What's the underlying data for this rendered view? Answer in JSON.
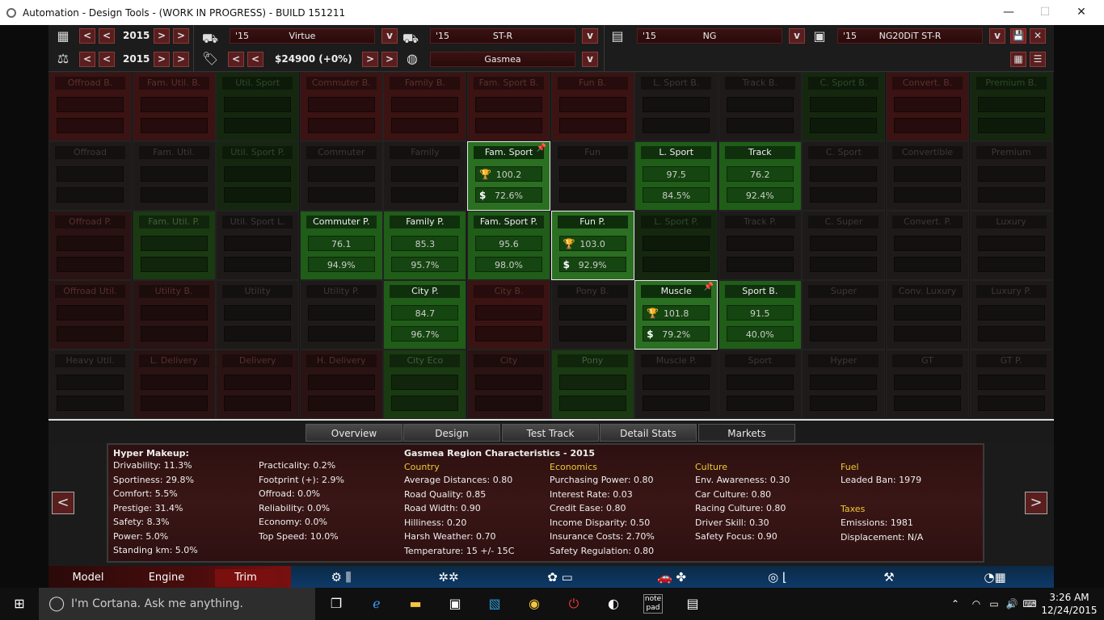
{
  "window": {
    "title": "Automation - Design Tools - (WORK IN PROGRESS) - BUILD 151211",
    "minimize": "—",
    "maximize": "☐",
    "close": "✕"
  },
  "topbar": {
    "year1": "2015",
    "year2": "2015",
    "price": "$24900 (+0%)",
    "model_year": "'15",
    "model_name": "Virtue",
    "trim_year": "'15",
    "trim_name": "ST-R",
    "region": "Gasmea",
    "engine_year": "'15",
    "engine_name": "NG",
    "variant_year": "'15",
    "variant_name": "NG20DiT ST-R",
    "btn_prev_prev": "<",
    "btn_prev": "<",
    "btn_next": ">",
    "btn_next_next": ">",
    "dropdown": "v",
    "save": "💾",
    "close": "✕"
  },
  "grid": {
    "rows": [
      [
        {
          "title": "Offroad B.",
          "c": "red"
        },
        {
          "title": "Fam. Util. B.",
          "c": "red"
        },
        {
          "title": "Util. Sport",
          "c": "dgreen"
        },
        {
          "title": "Commuter B.",
          "c": "red"
        },
        {
          "title": "Family B.",
          "c": "red"
        },
        {
          "title": "Fam. Sport B.",
          "c": "red"
        },
        {
          "title": "Fun B.",
          "c": "red"
        },
        {
          "title": "L. Sport B.",
          "c": "dgray"
        },
        {
          "title": "Track B.",
          "c": "dgray"
        },
        {
          "title": "C. Sport B.",
          "c": "dgreen"
        },
        {
          "title": "Convert. B.",
          "c": "red"
        },
        {
          "title": "Premium B.",
          "c": "dgreen"
        }
      ],
      [
        {
          "title": "Offroad",
          "c": "dgray"
        },
        {
          "title": "Fam. Util.",
          "c": "dgray"
        },
        {
          "title": "Util. Sport P.",
          "c": "dgreen"
        },
        {
          "title": "Commuter",
          "c": "dgray"
        },
        {
          "title": "Family",
          "c": "dgray"
        },
        {
          "title": "Fam. Sport",
          "c": "act",
          "hl": true,
          "pin": true,
          "v1": "100.2",
          "v2": "72.6%"
        },
        {
          "title": "Fun",
          "c": "dgray"
        },
        {
          "title": "L. Sport",
          "c": "act",
          "v1": "97.5",
          "v2": "84.5%"
        },
        {
          "title": "Track",
          "c": "act",
          "v1": "76.2",
          "v2": "92.4%"
        },
        {
          "title": "C. Sport",
          "c": "dgray"
        },
        {
          "title": "Convertible",
          "c": "dgray"
        },
        {
          "title": "Premium",
          "c": "dgray"
        }
      ],
      [
        {
          "title": "Offroad P.",
          "c": "dred"
        },
        {
          "title": "Fam. Util. P.",
          "c": "mgreen"
        },
        {
          "title": "Util. Sport L.",
          "c": "dgray"
        },
        {
          "title": "Commuter P.",
          "c": "act",
          "v1": "76.1",
          "v2": "94.9%"
        },
        {
          "title": "Family P.",
          "c": "act",
          "v1": "85.3",
          "v2": "95.7%"
        },
        {
          "title": "Fam. Sport P.",
          "c": "act",
          "v1": "95.6",
          "v2": "98.0%"
        },
        {
          "title": "Fun P.",
          "c": "act",
          "hl": true,
          "v1": "103.0",
          "v2": "92.9%"
        },
        {
          "title": "L. Sport P.",
          "c": "dgreen"
        },
        {
          "title": "Track P.",
          "c": "dgray"
        },
        {
          "title": "C. Super",
          "c": "dgray"
        },
        {
          "title": "Convert. P.",
          "c": "dgray"
        },
        {
          "title": "Luxury",
          "c": "dgray"
        }
      ],
      [
        {
          "title": "Offroad Util.",
          "c": "dred"
        },
        {
          "title": "Utility B.",
          "c": "dred"
        },
        {
          "title": "Utility",
          "c": "dgray"
        },
        {
          "title": "Utility P.",
          "c": "dgray"
        },
        {
          "title": "City P.",
          "c": "act",
          "v1": "84.7",
          "v2": "96.7%"
        },
        {
          "title": "City B.",
          "c": "red"
        },
        {
          "title": "Pony B.",
          "c": "dgray"
        },
        {
          "title": "Muscle",
          "c": "act",
          "hl": true,
          "pin": true,
          "v1": "101.8",
          "v2": "79.2%"
        },
        {
          "title": "Sport B.",
          "c": "act",
          "v1": "91.5",
          "v2": "40.0%"
        },
        {
          "title": "Super",
          "c": "dgray"
        },
        {
          "title": "Conv. Luxury",
          "c": "dgray"
        },
        {
          "title": "Luxury P.",
          "c": "dgray"
        }
      ],
      [
        {
          "title": "Heavy Util.",
          "c": "dgray"
        },
        {
          "title": "L. Delivery",
          "c": "dred"
        },
        {
          "title": "Delivery",
          "c": "dred"
        },
        {
          "title": "H. Delivery",
          "c": "dred"
        },
        {
          "title": "City Eco",
          "c": "mgreen"
        },
        {
          "title": "City",
          "c": "dred"
        },
        {
          "title": "Pony",
          "c": "mgreen"
        },
        {
          "title": "Muscle P.",
          "c": "dgray"
        },
        {
          "title": "Sport",
          "c": "dgray"
        },
        {
          "title": "Hyper",
          "c": "dgray"
        },
        {
          "title": "GT",
          "c": "dgray"
        },
        {
          "title": "GT P.",
          "c": "dgray"
        }
      ]
    ]
  },
  "tabs": [
    "Overview",
    "Design",
    "Test Track",
    "Detail Stats",
    "Markets"
  ],
  "info": {
    "makeup_title": "Hyper Makeup:",
    "makeup_col1": [
      "Drivability: 11.3%",
      "Sportiness: 29.8%",
      "Comfort: 5.5%",
      "Prestige: 31.4%",
      "Safety: 8.3%",
      "Power: 5.0%",
      "Standing km: 5.0%"
    ],
    "makeup_col2": [
      "Practicality: 0.2%",
      "Footprint (+): 2.9%",
      "Offroad: 0.0%",
      "Reliability: 0.0%",
      "Economy: 0.0%",
      "Top Speed: 10.0%"
    ],
    "region_title": "Gasmea Region Characteristics - 2015",
    "country_h": "Country",
    "country": [
      "Average Distances: 0.80",
      "Road Quality: 0.85",
      "Road Width: 0.90",
      "Hilliness: 0.20",
      "Harsh Weather: 0.70",
      "Temperature: 15 +/- 15C"
    ],
    "economics_h": "Economics",
    "economics": [
      "Purchasing Power: 0.80",
      "Interest Rate: 0.03",
      "Credit Ease: 0.80",
      "Income Disparity: 0.50",
      "Insurance Costs: 2.70%",
      "Safety Regulation: 0.80"
    ],
    "culture_h": "Culture",
    "culture": [
      "Env. Awareness: 0.30",
      "Car Culture: 0.80",
      "Racing Culture: 0.80",
      "Driver Skill: 0.30",
      "Safety Focus: 0.90"
    ],
    "fuel_h": "Fuel",
    "fuel": [
      "Leaded Ban: 1979"
    ],
    "taxes_h": "Taxes",
    "taxes": [
      "Emissions: 1981",
      "Displacement: N/A"
    ]
  },
  "nav": {
    "left": "<",
    "right": ">"
  },
  "bottom": {
    "model": "Model",
    "engine": "Engine",
    "trim": "Trim"
  },
  "taskbar": {
    "cortana": "I'm Cortana. Ask me anything.",
    "time": "3:26 AM",
    "date": "12/24/2015"
  }
}
